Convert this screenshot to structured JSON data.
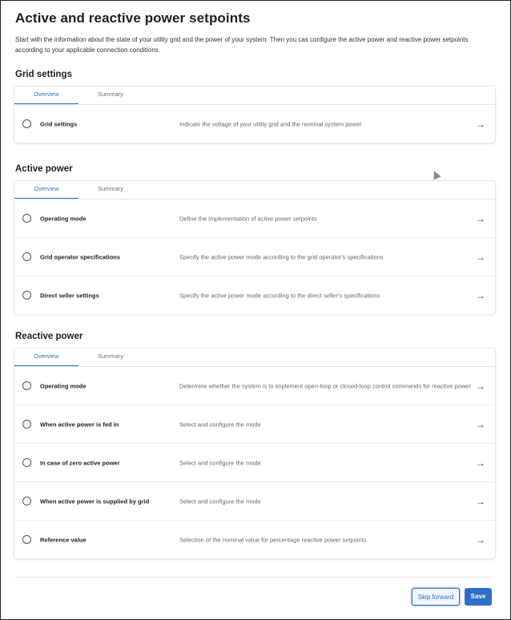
{
  "page": {
    "title": "Active and reactive power setpoints",
    "intro": "Start with the information about the state of your utility grid and the power of your system. Then you cas configure the active power and reactive power setpoints according to your applicable connection conditions."
  },
  "tabs": {
    "overview": "Overview",
    "summary": "Summary"
  },
  "sections": {
    "grid": {
      "title": "Grid settings",
      "rows": [
        {
          "label": "Grid settings",
          "desc": "Indicate the voltage of your utility grid and the nominal system power"
        }
      ]
    },
    "active": {
      "title": "Active power",
      "rows": [
        {
          "label": "Operating mode",
          "desc": "Define the implementation of active power setpoints"
        },
        {
          "label": "Grid operator specifications",
          "desc": "Specify the active power mode according to the grid operator's specifications"
        },
        {
          "label": "Direct seller settings",
          "desc": "Specify the active power mode according to the direct seller's specifications"
        }
      ]
    },
    "reactive": {
      "title": "Reactive power",
      "rows": [
        {
          "label": "Operating mode",
          "desc": "Determine whether the system is to implement open-loop or closed-loop control commands for reactive power"
        },
        {
          "label": "When active power is fed in",
          "desc": "Select and configure the mode"
        },
        {
          "label": "In case of zero active power",
          "desc": "Select and configure the mode"
        },
        {
          "label": "When active power is supplied by grid",
          "desc": "Select and configure the mode"
        },
        {
          "label": "Reference value",
          "desc": "Selection of the nominal value for percentage reactive power setpoints"
        }
      ]
    }
  },
  "icons": {
    "arrow": "→",
    "arrow_name": "arrow-right-icon",
    "radio_name": "radio-unchecked-icon"
  },
  "footer": {
    "skip_label": "Skip forward",
    "save_label": "Save"
  },
  "colors": {
    "accent": "#2f6fc6"
  }
}
